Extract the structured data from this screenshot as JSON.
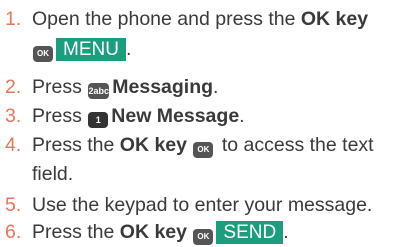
{
  "steps": [
    {
      "num": "1.",
      "line1_pre": "Open the phone and press the ",
      "line1_bold": "OK key",
      "key_ok": "OK",
      "softkey": "MENU",
      "line2_post": "."
    },
    {
      "num": "2.",
      "pre": "Press ",
      "key": "2abc",
      "bold": "Messaging",
      "post": "."
    },
    {
      "num": "3.",
      "pre": "Press ",
      "key": "1",
      "bold": "New Message",
      "post": "."
    },
    {
      "num": "4.",
      "pre": "Press the ",
      "bold": "OK key",
      "key_ok": "OK",
      "post": " to access the text",
      "line2": "field."
    },
    {
      "num": "5.",
      "text": "Use the keypad to enter your message."
    },
    {
      "num": "6.",
      "pre": "Press the ",
      "bold": "OK key",
      "key_ok": "OK",
      "softkey": "SEND",
      "post": "."
    }
  ],
  "colors": {
    "number": "#e8775a",
    "softkey_bg": "#1a9e7e",
    "key_bg": "#555555",
    "text": "#3a3a3a"
  }
}
